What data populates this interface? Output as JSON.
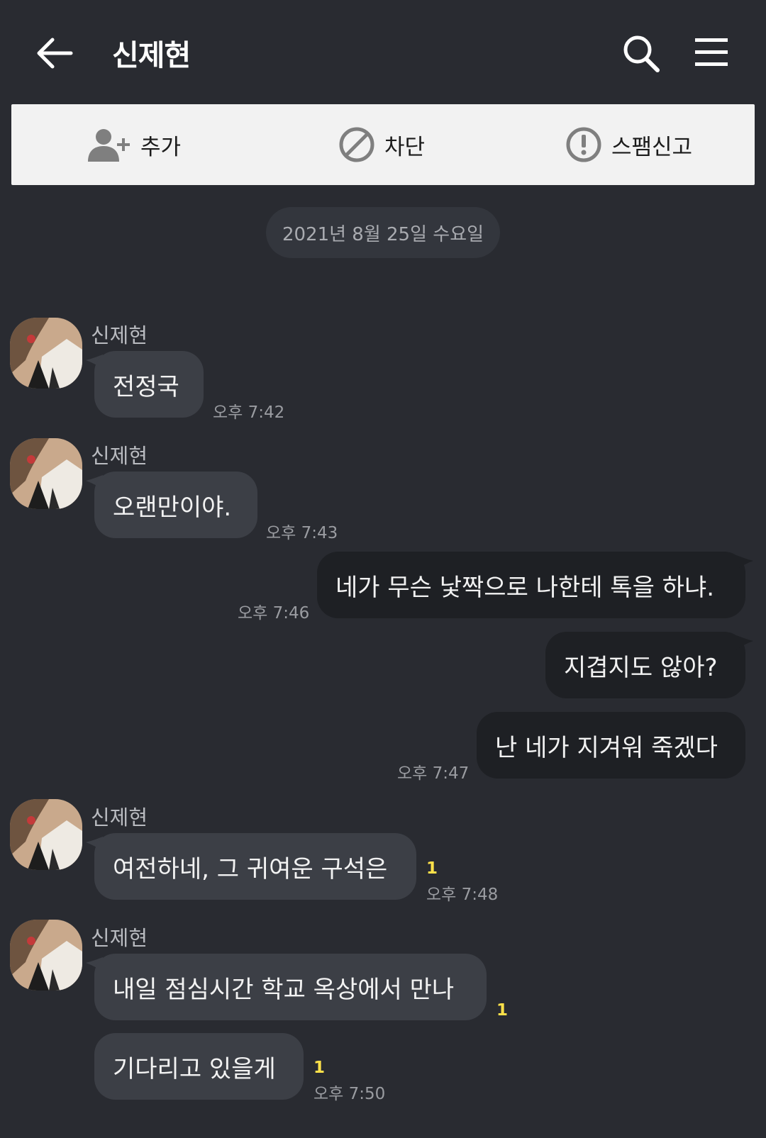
{
  "header": {
    "title": "신제현"
  },
  "actions": {
    "add_label": "추가",
    "block_label": "차단",
    "spam_label": "스팸신고"
  },
  "date_divider": "2021년 8월 25일 수요일",
  "messages": [
    {
      "sender": "신제현",
      "text": "전정국",
      "time": "오후 7:42"
    },
    {
      "sender": "신제현",
      "text": "오랜만이야.",
      "time": "오후 7:43"
    },
    {
      "text": "네가 무슨 낯짝으로 나한테 톡을 하냐.",
      "time": "오후 7:46"
    },
    {
      "text": "지겹지도 않아?"
    },
    {
      "text": "난 네가 지겨워 죽겠다",
      "time": "오후 7:47"
    },
    {
      "sender": "신제현",
      "text": "여전하네, 그 귀여운 구석은",
      "unread": "1",
      "time": "오후 7:48"
    },
    {
      "sender": "신제현",
      "text": "내일 점심시간 학교 옥상에서 만나",
      "unread": "1"
    },
    {
      "text": "기다리고 있을게",
      "unread": "1",
      "time": "오후 7:50"
    }
  ],
  "colors": {
    "background": "#292b31",
    "incoming_bubble": "#3c3f46",
    "outgoing_bubble": "#1e2024",
    "unread_count": "#ffe14a"
  }
}
